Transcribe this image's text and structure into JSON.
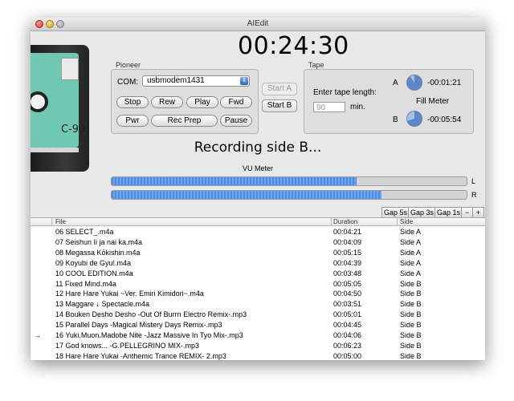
{
  "window": {
    "title": "AIEdit"
  },
  "timer": "00:24:30",
  "cassette": {
    "label": "C-90"
  },
  "pioneer": {
    "group_label": "Pioneer",
    "com_label": "COM:",
    "com_value": "usbmodem1431",
    "buttons": {
      "stop": "Stop",
      "rew": "Rew",
      "play": "Play",
      "fwd": "Fwd",
      "pwr": "Pwr",
      "rec_prep": "Rec Prep",
      "pause": "Pause"
    }
  },
  "start": {
    "a": "Start A",
    "b": "Start B"
  },
  "tape": {
    "group_label": "Tape",
    "length_label": "Enter tape length:",
    "length_placeholder": "90",
    "min_label": "min.",
    "side_a_label": "A",
    "side_a_time": "-00:01:21",
    "side_b_label": "B",
    "side_b_time": "-00:05:54",
    "fill_meter_label": "Fill Meter",
    "fill_a": 0.9,
    "fill_b": 0.7
  },
  "status": "Recording side B...",
  "vu": {
    "title": "VU Meter",
    "left_label": "L",
    "right_label": "R",
    "left_level": 0.69,
    "right_level": 0.76
  },
  "gap_buttons": {
    "gap5": "Gap 5s",
    "gap3": "Gap 3s",
    "gap1": "Gap 1s",
    "minus": "−",
    "plus": "+"
  },
  "table": {
    "headers": {
      "file": "File",
      "duration": "Duration",
      "side": "Side"
    },
    "rows": [
      {
        "marker": "",
        "file": "06 SELECT_.m4a",
        "duration": "00:04:21",
        "side": "Side A"
      },
      {
        "marker": "",
        "file": "07 Seishun Ii ja nai ka.m4a",
        "duration": "00:04:09",
        "side": "Side A"
      },
      {
        "marker": "",
        "file": "08 Megassa Kōkishin.m4a",
        "duration": "00:05:15",
        "side": "Side A"
      },
      {
        "marker": "",
        "file": "09 Koyubi de Gyu!.m4a",
        "duration": "00:04:39",
        "side": "Side A"
      },
      {
        "marker": "",
        "file": "10 COOL EDITION.m4a",
        "duration": "00:03:48",
        "side": "Side A"
      },
      {
        "marker": "",
        "file": "11 Fixed Mind.m4a",
        "duration": "00:05:05",
        "side": "Side B"
      },
      {
        "marker": "",
        "file": "12 Hare Hare Yukai ~Ver. Emiri Kimidori~.m4a",
        "duration": "00:04:50",
        "side": "Side B"
      },
      {
        "marker": "",
        "file": "13 Maggare ↓ Spectacle.m4a",
        "duration": "00:03:51",
        "side": "Side B"
      },
      {
        "marker": "",
        "file": "14  Bouken Desho Desho -Out Of Burrn Electro Remix-.mp3",
        "duration": "00:05:01",
        "side": "Side B"
      },
      {
        "marker": "",
        "file": "15 Parallel Days -Magical Mistery Days Remix-.mp3",
        "duration": "00:04:45",
        "side": "Side B"
      },
      {
        "marker": "→",
        "file": "16 Yuki.Muon.Madobe Nite -Jazz Massive In Tyo Mix-.mp3",
        "duration": "00:04:06",
        "side": "Side B"
      },
      {
        "marker": "",
        "file": "17 God knows... -G.PELLEGRINO MIX-.mp3",
        "duration": "00:06:23",
        "side": "Side B"
      },
      {
        "marker": "",
        "file": "18  Hare Hare Yukai -Anthemic Trance REMIX- 2.mp3",
        "duration": "00:05:00",
        "side": "Side B"
      }
    ]
  }
}
